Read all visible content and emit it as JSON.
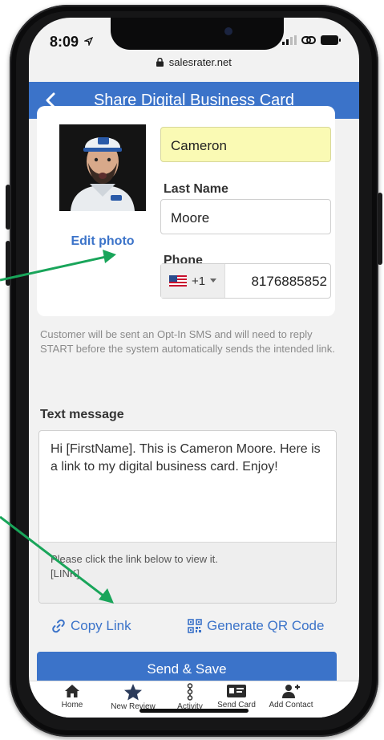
{
  "status_bar": {
    "time": "8:09"
  },
  "browser": {
    "url": "salesrater.net"
  },
  "header": {
    "title": "Share Digital Business Card"
  },
  "form": {
    "first_name_value": "Cameron",
    "last_name_label": "Last Name",
    "last_name_value": "Moore",
    "phone_label": "Phone",
    "country_code": "+1",
    "phone_value": "8176885852",
    "edit_photo_label": "Edit photo"
  },
  "opt_in_note": "Customer will be sent an Opt-In SMS and will need to reply START before the system automatically sends the intended link.",
  "text_message": {
    "title": "Text message",
    "body": "Hi [FirstName]. This is Cameron Moore. Here is a link to my digital business card. Enjoy!",
    "footer_line1": "Please click the link below to view it.",
    "footer_line2": "[LINK]"
  },
  "actions": {
    "copy_link": "Copy Link",
    "generate_qr": "Generate QR Code",
    "send_save": "Send & Save"
  },
  "tabs": [
    {
      "label": "Home",
      "icon": "home-icon"
    },
    {
      "label": "New Review",
      "icon": "star-icon"
    },
    {
      "label": "Activity",
      "icon": "activity-icon"
    },
    {
      "label": "Send Card",
      "icon": "id-card-icon"
    },
    {
      "label": "Add Contact",
      "icon": "add-user-icon"
    }
  ],
  "colors": {
    "accent": "#3b73c9",
    "highlight_field": "#fafab4",
    "arrow": "#19a55a"
  }
}
